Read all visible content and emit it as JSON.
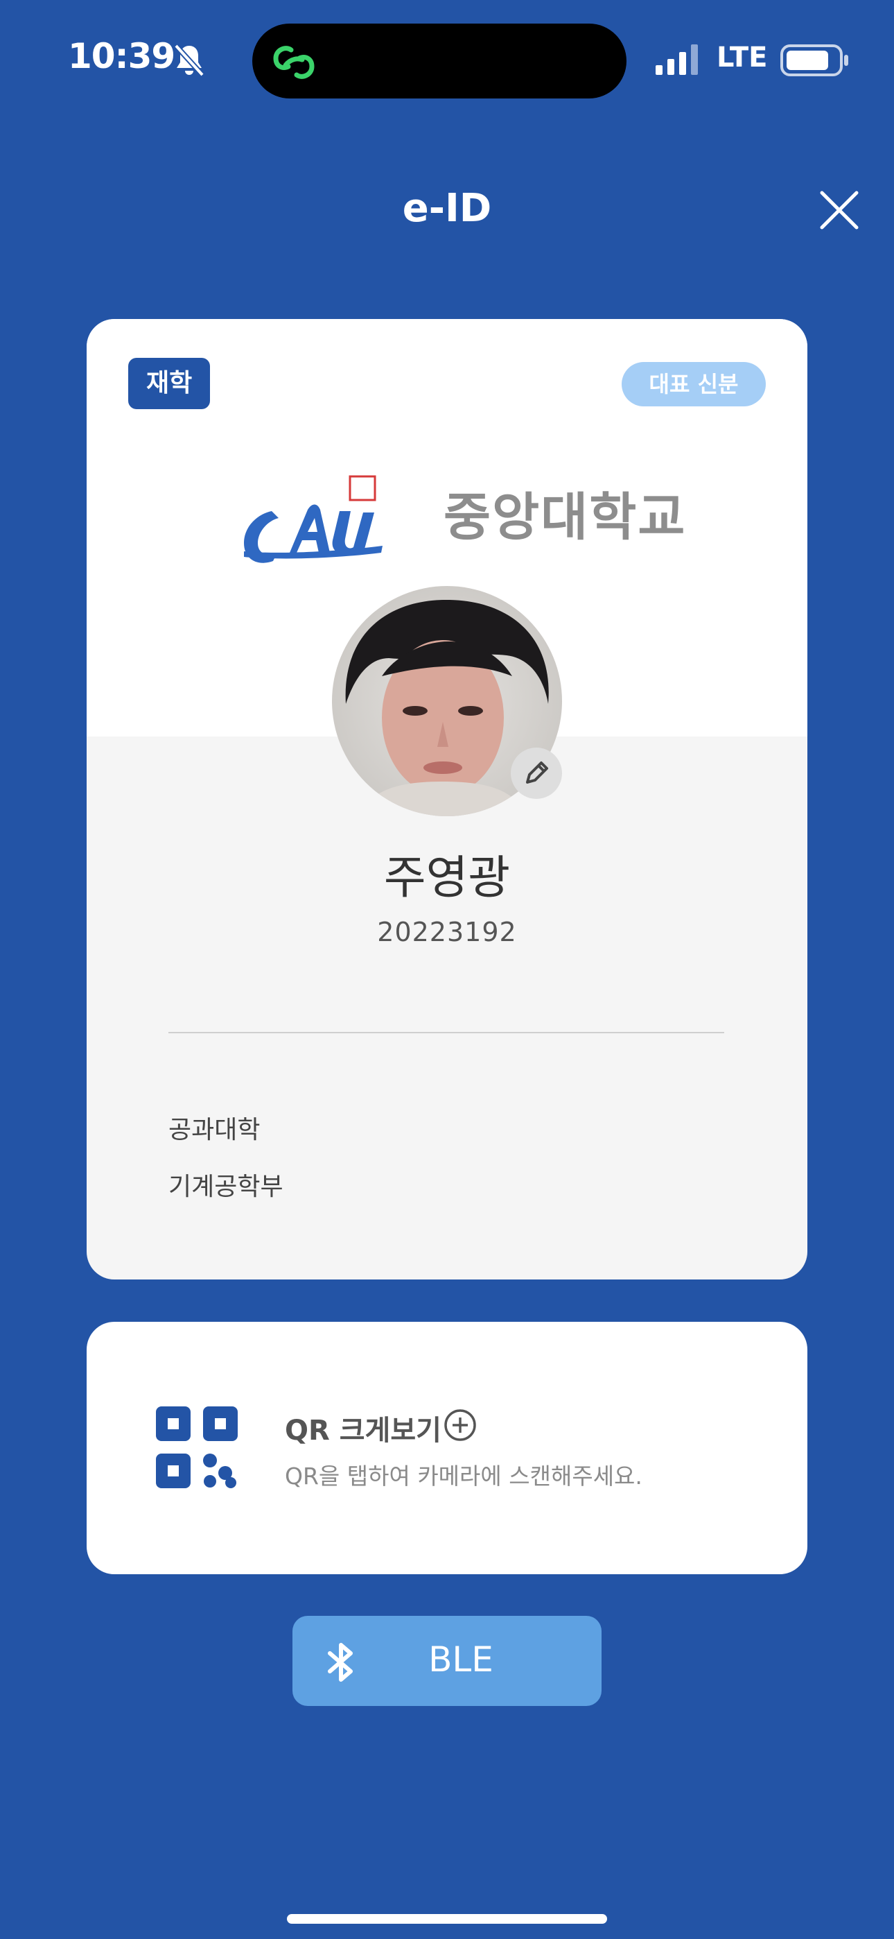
{
  "status_bar": {
    "time": "10:39",
    "network": "LTE",
    "icons": [
      "bell-off-icon",
      "linked-app-icon",
      "signal-icon",
      "battery-icon"
    ]
  },
  "header": {
    "title": "e-ID",
    "close_icon": "close-icon"
  },
  "card": {
    "status_badge": "재학",
    "primary_badge": "대표 신분",
    "logo_text": "CAU",
    "university_name": "중앙대학교",
    "name": "주영광",
    "student_id": "20223192",
    "college": "공과대학",
    "department": "기계공학부",
    "edit_icon": "pencil-icon"
  },
  "qr": {
    "title": "QR 크게보기",
    "subtitle": "QR을 탭하여 카메라에 스캔해주세요.",
    "icon": "qr-code-icon",
    "plus_icon": "plus-circle-icon"
  },
  "ble": {
    "label": "BLE",
    "icon": "bluetooth-icon"
  },
  "colors": {
    "background": "#2354a6",
    "badge_status": "#2354a6",
    "badge_primary": "#a5cef6",
    "ble_button": "#5ea1e2"
  }
}
